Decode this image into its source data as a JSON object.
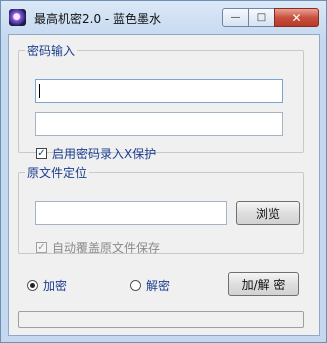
{
  "window": {
    "title": "最高机密2.0 - 蓝色墨水",
    "minimize_glyph": "—",
    "maximize_glyph": "□",
    "close_glyph": "✕"
  },
  "password_group": {
    "legend": "密码输入",
    "field1_value": "",
    "field2_value": "",
    "protect_checkbox_label": "启用密码录入X保护",
    "protect_checked": true
  },
  "file_group": {
    "legend": "原文件定位",
    "path_value": "",
    "browse_label": "浏览",
    "overwrite_checkbox_label": "自动覆盖原文件保存",
    "overwrite_checked": true,
    "overwrite_enabled": false
  },
  "mode": {
    "encrypt_label": "加密",
    "decrypt_label": "解密",
    "selected": "encrypt",
    "action_label": "加/解 密"
  },
  "status": {
    "text": ""
  }
}
